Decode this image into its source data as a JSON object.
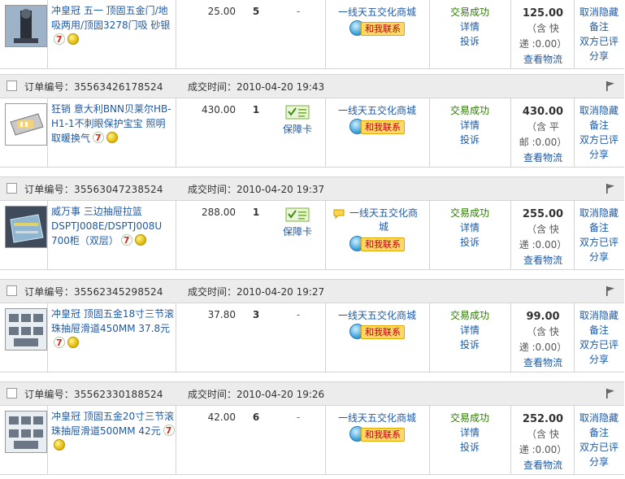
{
  "labels": {
    "order_no_prefix": "订单编号：",
    "deal_time_prefix": "成交时间：",
    "contact_button": "和我联系",
    "guarantee_card": "保障卡",
    "status_success": "交易成功",
    "status_detail": "详情",
    "status_complain": "投诉",
    "view_logistics": "查看物流",
    "op_cancel_favorite": "取消隐藏",
    "op_note": "备注",
    "op_both_reviewed": "双方已评",
    "op_share": "分享"
  },
  "orders": [
    {
      "order_no": "",
      "deal_time": "",
      "title": "冲皇冠 五一 顶固五金门/地吸两用/顶固3278门吸 砂银",
      "unit_price": "25.00",
      "quantity": "5",
      "guarantee": "-",
      "seller": "一线天五交化商城",
      "total": "125.00",
      "pay_note_1": "（含 快",
      "pay_note_2": "递 :0.00）"
    },
    {
      "order_no": "35563426178524",
      "deal_time": "2010-04-20 19:43",
      "title": "狂销 意大利BNN贝莱尔HB-H1-1不刺眼保护宝宝 照明取暖换气",
      "unit_price": "430.00",
      "quantity": "1",
      "guarantee": "保障卡",
      "seller": "一线天五交化商城",
      "total": "430.00",
      "pay_note_1": "（含 平",
      "pay_note_2": "邮 :0.00）"
    },
    {
      "order_no": "35563047238524",
      "deal_time": "2010-04-20 19:37",
      "title": "威万事 三边抽屉拉篮 DSPTJ008E/DSPTJ008U 700柜（双层）",
      "unit_price": "288.00",
      "quantity": "1",
      "guarantee": "保障卡",
      "seller": "一线天五交化商城",
      "total": "255.00",
      "pay_note_1": "（含 快",
      "pay_note_2": "递 :0.00）"
    },
    {
      "order_no": "35562345298524",
      "deal_time": "2010-04-20 19:27",
      "title": "冲皇冠 顶固五金18寸三节滚珠抽屉滑道450MM 37.8元",
      "unit_price": "37.80",
      "quantity": "3",
      "guarantee": "-",
      "seller": "一线天五交化商城",
      "total": "99.00",
      "pay_note_1": "（含 快",
      "pay_note_2": "递 :0.00）"
    },
    {
      "order_no": "35562330188524",
      "deal_time": "2010-04-20 19:26",
      "title": "冲皇冠 顶固五金20寸三节滚珠抽屉滑道500MM 42元",
      "unit_price": "42.00",
      "quantity": "6",
      "guarantee": "-",
      "seller": "一线天五交化商城",
      "total": "252.00",
      "pay_note_1": "（含 快",
      "pay_note_2": "递 :0.00）"
    }
  ]
}
